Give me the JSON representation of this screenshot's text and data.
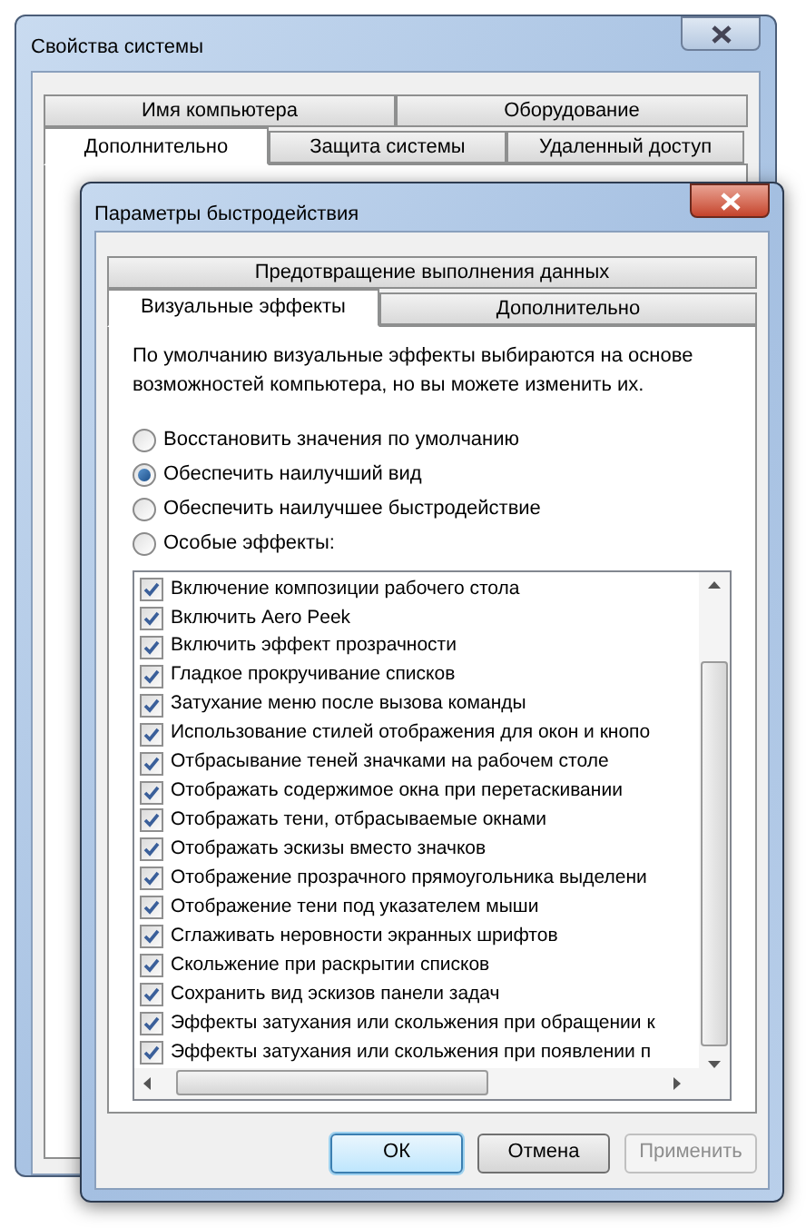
{
  "back_window": {
    "title": "Свойства системы",
    "tab_rows": [
      [
        {
          "label": "Имя компьютера",
          "selected": false
        },
        {
          "label": "Оборудование",
          "selected": false
        }
      ],
      [
        {
          "label": "Дополнительно",
          "selected": true
        },
        {
          "label": "Защита системы",
          "selected": false
        },
        {
          "label": "Удаленный доступ",
          "selected": false
        }
      ]
    ]
  },
  "dialog": {
    "title": "Параметры быстродействия",
    "tab_rows": [
      [
        {
          "label": "Предотвращение выполнения данных",
          "selected": false
        }
      ],
      [
        {
          "label": "Визуальные эффекты",
          "selected": true
        },
        {
          "label": "Дополнительно",
          "selected": false
        }
      ]
    ],
    "description": "По умолчанию визуальные эффекты выбираются на основе возможностей компьютера, но вы можете изменить их.",
    "options": [
      {
        "label": "Восстановить значения по умолчанию",
        "selected": false
      },
      {
        "label": "Обеспечить наилучший вид",
        "selected": true
      },
      {
        "label": "Обеспечить наилучшее быстродействие",
        "selected": false
      },
      {
        "label": "Особые эффекты:",
        "selected": false
      }
    ],
    "effects": [
      {
        "label": "Включение композиции рабочего стола",
        "checked": true
      },
      {
        "label": "Включить Aero Peek",
        "checked": true
      },
      {
        "label": "Включить эффект прозрачности",
        "checked": true
      },
      {
        "label": "Гладкое прокручивание списков",
        "checked": true
      },
      {
        "label": "Затухание меню после вызова команды",
        "checked": true
      },
      {
        "label": "Использование стилей отображения для окон и кнопо",
        "checked": true
      },
      {
        "label": "Отбрасывание теней значками на рабочем столе",
        "checked": true
      },
      {
        "label": "Отображать содержимое окна при перетаскивании",
        "checked": true
      },
      {
        "label": "Отображать тени, отбрасываемые окнами",
        "checked": true
      },
      {
        "label": "Отображать эскизы вместо значков",
        "checked": true
      },
      {
        "label": "Отображение прозрачного прямоугольника выделени",
        "checked": true
      },
      {
        "label": "Отображение тени под указателем мыши",
        "checked": true
      },
      {
        "label": "Сглаживать неровности экранных шрифтов",
        "checked": true
      },
      {
        "label": "Скольжение при раскрытии списков",
        "checked": true
      },
      {
        "label": "Сохранить вид эскизов панели задач",
        "checked": true
      },
      {
        "label": "Эффекты затухания или скольжения при обращении к",
        "checked": true
      },
      {
        "label": "Эффекты затухания или скольжения при появлении п",
        "checked": true
      }
    ],
    "buttons": [
      {
        "label": "ОК",
        "default": true,
        "disabled": false
      },
      {
        "label": "Отмена",
        "default": false,
        "disabled": false
      },
      {
        "label": "Применить",
        "default": false,
        "disabled": true
      }
    ]
  }
}
